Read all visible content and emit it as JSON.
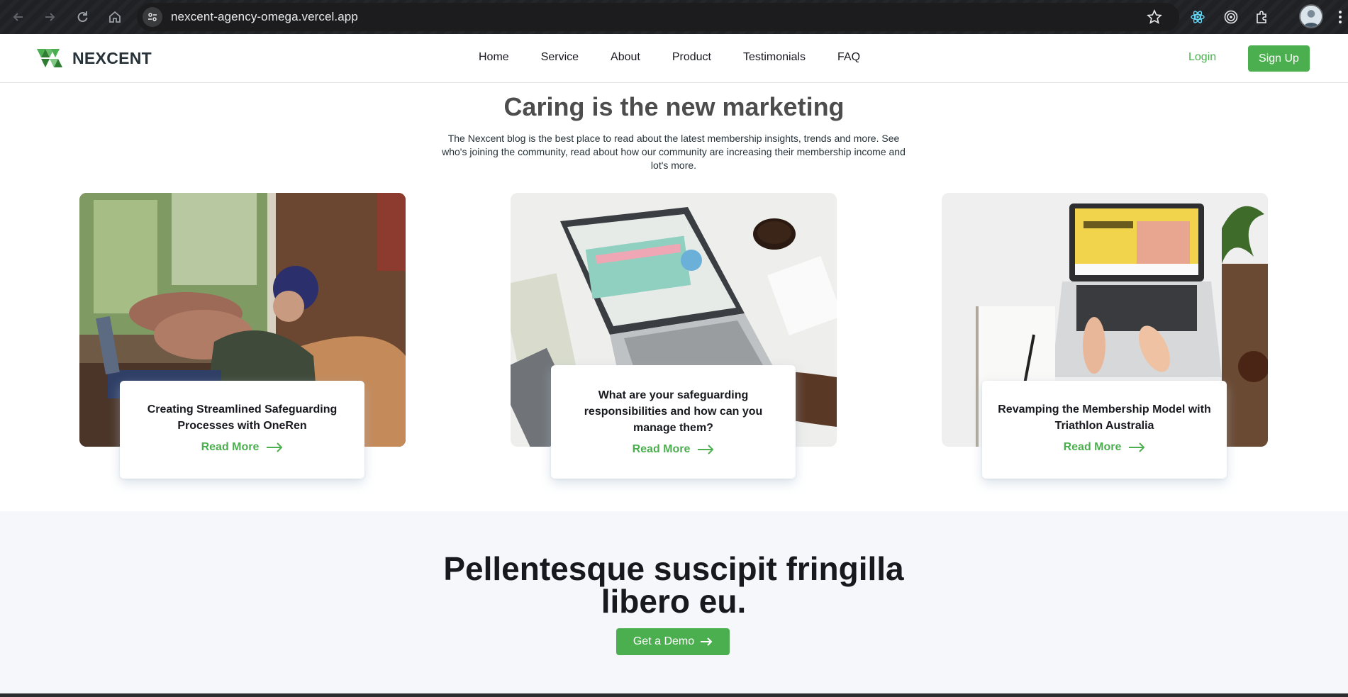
{
  "browser": {
    "url": "nexcent-agency-omega.vercel.app"
  },
  "header": {
    "logo_text": "NEXCENT",
    "nav": [
      {
        "label": "Home"
      },
      {
        "label": "Service"
      },
      {
        "label": "About"
      },
      {
        "label": "Product"
      },
      {
        "label": "Testimonials"
      },
      {
        "label": "FAQ"
      }
    ],
    "login_label": "Login",
    "signup_label": "Sign Up"
  },
  "blog": {
    "title": "Caring is the new marketing",
    "description": "The Nexcent blog is the best place to read about the latest membership insights, trends and more. See who's joining the community, read about how our community are increasing their membership income and lot's more.",
    "cards": [
      {
        "title": "Creating Streamlined Safeguarding Processes with OneRen",
        "link": "Read More"
      },
      {
        "title": "What are your safeguarding responsibilities and how can you manage them?",
        "link": "Read More"
      },
      {
        "title": "Revamping the Membership Model with Triathlon Australia",
        "link": "Read More"
      }
    ]
  },
  "cta": {
    "title": "Pellentesque suscipit fringilla libero eu.",
    "button_label": "Get a Demo"
  },
  "colors": {
    "brand_green": "#4caf4f",
    "heading_dark": "#18191f",
    "section_gray": "#f5f7fa"
  }
}
